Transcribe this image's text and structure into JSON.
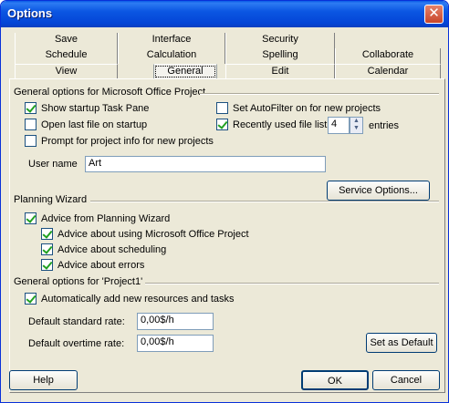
{
  "window": {
    "title": "Options",
    "close_glyph": "✕"
  },
  "tabs": {
    "row1": [
      "Save",
      "Interface",
      "Security"
    ],
    "row2": [
      "Schedule",
      "Calculation",
      "Spelling",
      "Collaborate"
    ],
    "row3": [
      "View",
      "General",
      "Edit",
      "Calendar"
    ],
    "active": "General"
  },
  "general": {
    "group_label": "General options for Microsoft Office Project",
    "show_taskpane": {
      "label": "Show startup Task Pane",
      "checked": true
    },
    "open_last_file": {
      "label": "Open last file on startup",
      "checked": false
    },
    "prompt_info": {
      "label": "Prompt for project info for new projects",
      "checked": false
    },
    "autofilter": {
      "label": "Set AutoFilter on for new projects",
      "checked": false
    },
    "recent_files": {
      "label": "Recently used file list:",
      "checked": true,
      "value": "4",
      "suffix": "entries"
    },
    "user_name_label": "User name",
    "user_name_value": "Art",
    "service_options_button": "Service Options..."
  },
  "planning": {
    "group_label": "Planning Wizard",
    "advice_wizard": {
      "label": "Advice from Planning Wizard",
      "checked": true
    },
    "advice_using": {
      "label": "Advice about using Microsoft Office Project",
      "checked": true
    },
    "advice_scheduling": {
      "label": "Advice about scheduling",
      "checked": true
    },
    "advice_errors": {
      "label": "Advice about errors",
      "checked": true
    }
  },
  "project": {
    "group_label": "General options for 'Project1'",
    "auto_add": {
      "label": "Automatically add new resources and tasks",
      "checked": true
    },
    "std_rate_label": "Default standard rate:",
    "std_rate_value": "0,00$/h",
    "ovt_rate_label": "Default overtime rate:",
    "ovt_rate_value": "0,00$/h",
    "set_default_button": "Set as Default"
  },
  "footer": {
    "help": "Help",
    "ok": "OK",
    "cancel": "Cancel"
  }
}
